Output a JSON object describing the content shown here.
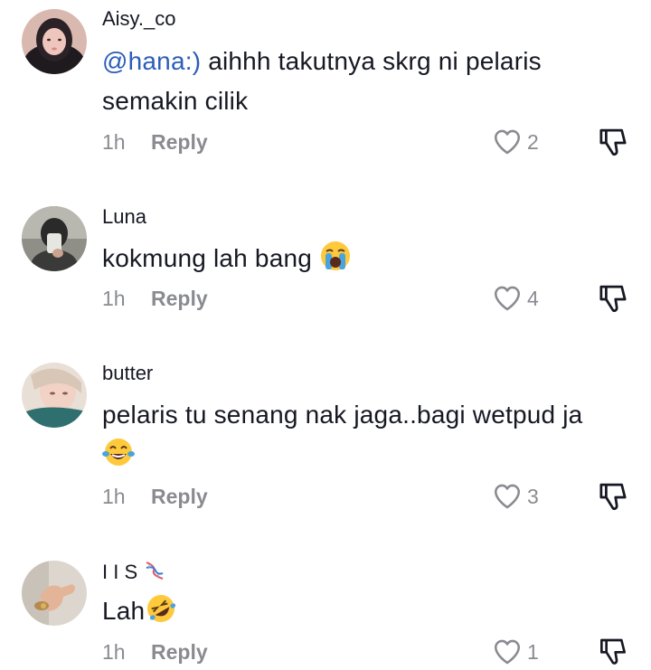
{
  "comments": [
    {
      "username": "Aisy._co",
      "mention": "@hana:)",
      "text_line1": " aihhh takutnya skrg ni pelaris",
      "text_line2": "semakin cilik",
      "time": "1h",
      "reply_label": "Reply",
      "likes": "2"
    },
    {
      "username": "Luna",
      "text": "kokmung lah bang",
      "emoji": "loudly-crying-face",
      "time": "1h",
      "reply_label": "Reply",
      "likes": "4"
    },
    {
      "username": "butter",
      "text": "pelaris tu senang nak jaga..bagi wetpud ja",
      "emoji": "tears-of-joy-face",
      "time": "1h",
      "reply_label": "Reply",
      "likes": "3"
    },
    {
      "username": "I I S",
      "username_emoji": "dna",
      "text": "Lah",
      "emoji": "rolling-on-floor-laughing-face",
      "time": "1h",
      "reply_label": "Reply",
      "likes": "1"
    }
  ],
  "colors": {
    "text": "#161823",
    "mention": "#2b5db9",
    "meta": "#8a8b91",
    "emoji_yellow": "#ffc93c",
    "emoji_tear": "#4aa3df"
  },
  "icons": [
    "heart-outline-icon",
    "thumbs-down-outline-icon"
  ]
}
